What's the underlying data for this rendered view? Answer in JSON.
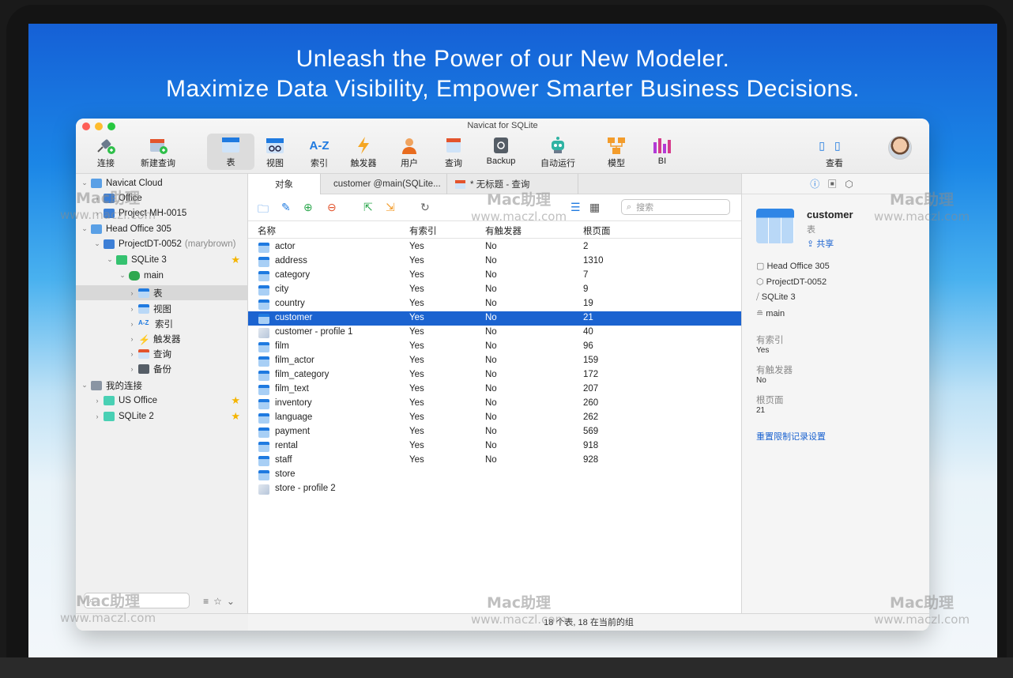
{
  "headline": {
    "line1": "Unleash the Power of our New Modeler.",
    "line2": "Maximize Data Visibility, Empower Smarter Business Decisions."
  },
  "window": {
    "title": "Navicat for SQLite",
    "toolbar": [
      {
        "label": "连接",
        "icon": "plug-icon"
      },
      {
        "label": "新建查询",
        "icon": "new-query-icon"
      },
      {
        "label": "表",
        "icon": "table-icon"
      },
      {
        "label": "视图",
        "icon": "view-icon"
      },
      {
        "label": "索引",
        "icon": "index-icon"
      },
      {
        "label": "触发器",
        "icon": "trigger-icon"
      },
      {
        "label": "用户",
        "icon": "user-icon"
      },
      {
        "label": "查询",
        "icon": "query-icon"
      },
      {
        "label": "Backup",
        "icon": "backup-icon"
      },
      {
        "label": "自动运行",
        "icon": "robot-icon"
      },
      {
        "label": "模型",
        "icon": "model-icon"
      },
      {
        "label": "BI",
        "icon": "bi-icon"
      }
    ],
    "view_label": "查看"
  },
  "sidebar": {
    "items": [
      {
        "label": "Navicat Cloud",
        "level": 0
      },
      {
        "label": "Office",
        "level": 1
      },
      {
        "label": "Project MH-0015",
        "level": 1
      },
      {
        "label": "Head Office 305",
        "level": 0
      },
      {
        "label": "ProjectDT-0052",
        "extra": "(marybrown)",
        "level": 1
      },
      {
        "label": "SQLite 3",
        "level": 2,
        "starred": true
      },
      {
        "label": "main",
        "level": 3
      },
      {
        "label": "表",
        "level": 4,
        "selected": true
      },
      {
        "label": "视图",
        "level": 4
      },
      {
        "label": "索引",
        "level": 4
      },
      {
        "label": "触发器",
        "level": 4
      },
      {
        "label": "查询",
        "level": 4
      },
      {
        "label": "备份",
        "level": 4
      },
      {
        "label": "我的连接",
        "level": 0
      },
      {
        "label": "US Office",
        "level": 1,
        "starred": true
      },
      {
        "label": "SQLite 2",
        "level": 1,
        "starred": true
      }
    ]
  },
  "tabs": [
    "对象",
    "customer @main(SQLite...",
    "* 无标题 - 查询"
  ],
  "search": {
    "placeholder": "搜索"
  },
  "table": {
    "columns": [
      "名称",
      "有索引",
      "有触发器",
      "根页面"
    ],
    "rows": [
      {
        "name": "actor",
        "idx": "Yes",
        "trg": "No",
        "root": "2"
      },
      {
        "name": "address",
        "idx": "Yes",
        "trg": "No",
        "root": "1310"
      },
      {
        "name": "category",
        "idx": "Yes",
        "trg": "No",
        "root": "7"
      },
      {
        "name": "city",
        "idx": "Yes",
        "trg": "No",
        "root": "9"
      },
      {
        "name": "country",
        "idx": "Yes",
        "trg": "No",
        "root": "19"
      },
      {
        "name": "customer",
        "idx": "Yes",
        "trg": "No",
        "root": "21",
        "selected": true
      },
      {
        "name": "customer - profile 1",
        "idx": "Yes",
        "trg": "No",
        "root": "40",
        "profile": true
      },
      {
        "name": "film",
        "idx": "Yes",
        "trg": "No",
        "root": "96"
      },
      {
        "name": "film_actor",
        "idx": "Yes",
        "trg": "No",
        "root": "159"
      },
      {
        "name": "film_category",
        "idx": "Yes",
        "trg": "No",
        "root": "172"
      },
      {
        "name": "film_text",
        "idx": "Yes",
        "trg": "No",
        "root": "207"
      },
      {
        "name": "inventory",
        "idx": "Yes",
        "trg": "No",
        "root": "260"
      },
      {
        "name": "language",
        "idx": "Yes",
        "trg": "No",
        "root": "262"
      },
      {
        "name": "payment",
        "idx": "Yes",
        "trg": "No",
        "root": "569"
      },
      {
        "name": "rental",
        "idx": "Yes",
        "trg": "No",
        "root": "918"
      },
      {
        "name": "staff",
        "idx": "Yes",
        "trg": "No",
        "root": "928"
      },
      {
        "name": "store",
        "idx": "",
        "trg": "",
        "root": ""
      },
      {
        "name": "store - profile 2",
        "idx": "",
        "trg": "",
        "root": "",
        "profile": true
      }
    ]
  },
  "status": "18 个表, 18 在当前的组",
  "detail": {
    "name": "customer",
    "type": "表",
    "share": "共享",
    "path": [
      "Head Office 305",
      "ProjectDT-0052",
      "SQLite 3",
      "main"
    ],
    "fields": [
      {
        "label": "有索引",
        "value": "Yes"
      },
      {
        "label": "有触发器",
        "value": "No"
      },
      {
        "label": "根页面",
        "value": "21"
      }
    ],
    "reset_link": "重置限制记录设置"
  },
  "watermark": {
    "brand": "Mac助理",
    "url": "www.maczl.com"
  }
}
